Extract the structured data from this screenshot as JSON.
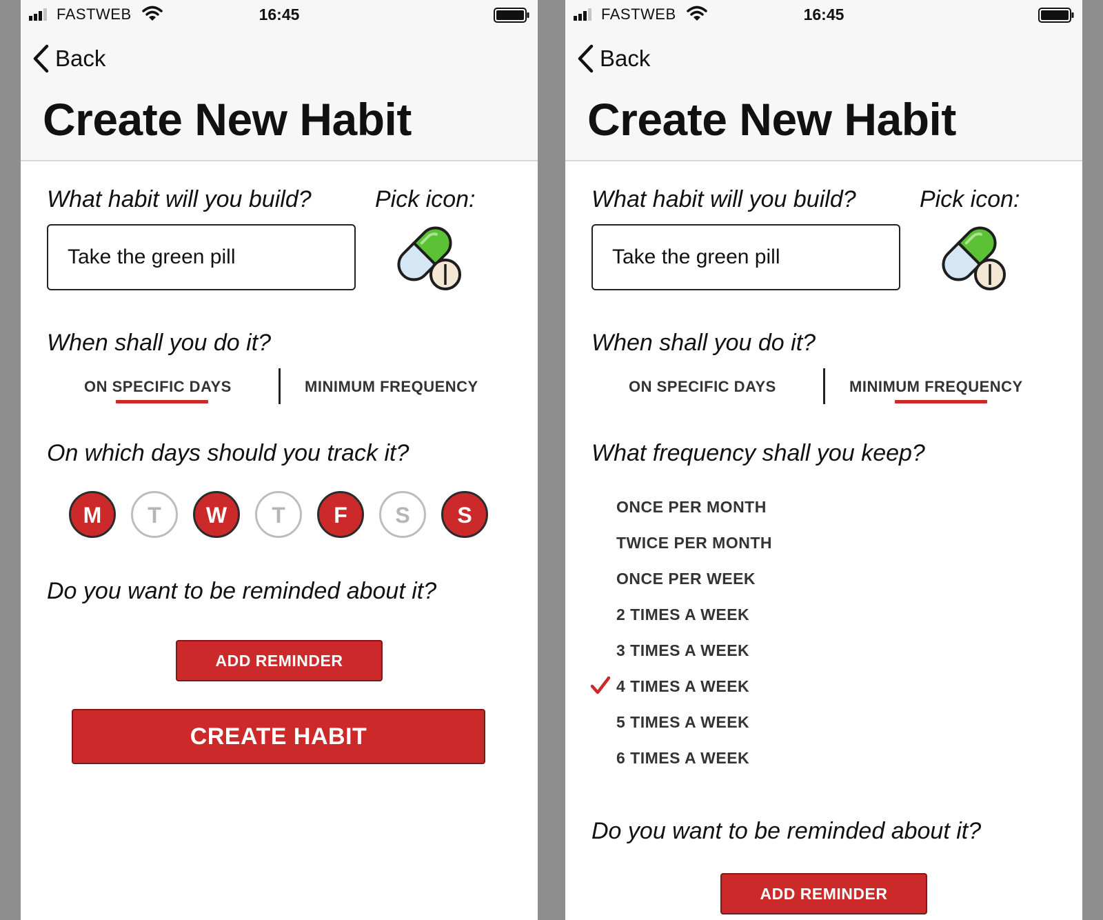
{
  "left_screen": {
    "status_bar": {
      "carrier": "FASTWEB",
      "time": "16:45"
    },
    "nav": {
      "back_label": "Back"
    },
    "title": "Create New Habit",
    "habit_question": "What habit will you build?",
    "habit_value": "Take the green pill",
    "icon_question": "Pick icon:",
    "icon_name": "pill-icon",
    "when_question": "When shall you do it?",
    "tabs": [
      {
        "label": "ON SPECIFIC DAYS",
        "selected": true
      },
      {
        "label": "MINIMUM FREQUENCY",
        "selected": false
      }
    ],
    "days_question": "On which days should you track it?",
    "days": [
      {
        "label": "M",
        "selected": true
      },
      {
        "label": "T",
        "selected": false
      },
      {
        "label": "W",
        "selected": true
      },
      {
        "label": "T",
        "selected": false
      },
      {
        "label": "F",
        "selected": true
      },
      {
        "label": "S",
        "selected": false
      },
      {
        "label": "S",
        "selected": true
      }
    ],
    "reminder_question": "Do you want to be reminded about it?",
    "add_reminder_label": "ADD REMINDER",
    "create_habit_label": "CREATE HABIT"
  },
  "right_screen": {
    "status_bar": {
      "carrier": "FASTWEB",
      "time": "16:45"
    },
    "nav": {
      "back_label": "Back"
    },
    "title": "Create New Habit",
    "habit_question": "What habit will you build?",
    "habit_value": "Take the green pill",
    "icon_question": "Pick icon:",
    "icon_name": "pill-icon",
    "when_question": "When shall you do it?",
    "tabs": [
      {
        "label": "ON SPECIFIC DAYS",
        "selected": false
      },
      {
        "label": "MINIMUM FREQUENCY",
        "selected": true
      }
    ],
    "frequency_question": "What frequency shall you keep?",
    "frequency_options": [
      {
        "label": "ONCE PER MONTH",
        "selected": false
      },
      {
        "label": "TWICE PER MONTH",
        "selected": false
      },
      {
        "label": "ONCE PER WEEK",
        "selected": false
      },
      {
        "label": "2 TIMES A WEEK",
        "selected": false
      },
      {
        "label": "3 TIMES A WEEK",
        "selected": false
      },
      {
        "label": "4 TIMES A WEEK",
        "selected": true
      },
      {
        "label": "5 TIMES A WEEK",
        "selected": false
      },
      {
        "label": "6 TIMES A WEEK",
        "selected": false
      }
    ],
    "reminder_question": "Do you want to be reminded about it?",
    "add_reminder_label": "ADD REMINDER"
  },
  "colors": {
    "accent": "#cc2a2a",
    "header_bg": "#f7f7f7",
    "outer_bg": "#8e8e8e",
    "pill_green": "#5bc236",
    "pill_blue": "#d6e6f2"
  }
}
